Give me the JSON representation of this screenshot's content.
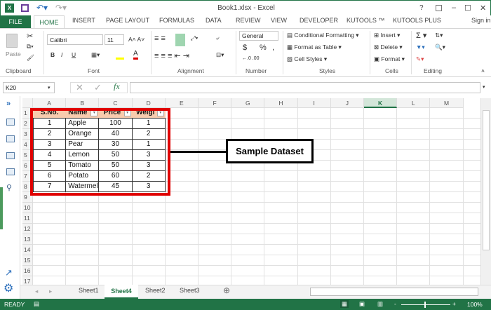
{
  "window": {
    "title": "Book1.xlsx - Excel",
    "help": "?",
    "minimize": "–",
    "maximize": "☐",
    "close": "✕"
  },
  "ribbon_tabs": [
    "FILE",
    "HOME",
    "INSERT",
    "PAGE LAYOUT",
    "FORMULAS",
    "DATA",
    "REVIEW",
    "VIEW",
    "DEVELOPER",
    "KUTOOLS ™",
    "KUTOOLS PLUS"
  ],
  "sign_in": "Sign in",
  "ribbon": {
    "paste": "Paste",
    "font_name": "Calibri",
    "font_size": "11",
    "bold": "B",
    "italic": "I",
    "underline": "U",
    "number_format": "General",
    "currency": "$",
    "percent": "%",
    "comma": ",",
    "conditional_formatting": "Conditional Formatting ▾",
    "format_as_table": "Format as Table ▾",
    "cell_styles": "Cell Styles ▾",
    "insert": "Insert ▾",
    "delete": "Delete ▾",
    "format": "Format ▾",
    "sum": "Σ ▾",
    "groups": [
      "Clipboard",
      "Font",
      "Alignment",
      "Number",
      "Styles",
      "Cells",
      "Editing"
    ]
  },
  "formula_bar": {
    "name_box": "K20",
    "fx": "fx",
    "cancel": "✕",
    "enter": "✓",
    "value": ""
  },
  "columns": [
    "A",
    "B",
    "C",
    "D",
    "E",
    "F",
    "G",
    "H",
    "I",
    "J",
    "K",
    "L",
    "M"
  ],
  "rows": [
    "1",
    "2",
    "3",
    "4",
    "5",
    "6",
    "7",
    "8",
    "9",
    "10",
    "11",
    "12",
    "13",
    "14",
    "15",
    "16",
    "17"
  ],
  "selected_column": "K",
  "table": {
    "headers": [
      "S.No.",
      "Name",
      "Price",
      "Weigl"
    ],
    "rows": [
      [
        "1",
        "Apple",
        "100",
        "1"
      ],
      [
        "2",
        "Orange",
        "40",
        "2"
      ],
      [
        "3",
        "Pear",
        "30",
        "1"
      ],
      [
        "4",
        "Lemon",
        "50",
        "3"
      ],
      [
        "5",
        "Tomato",
        "50",
        "3"
      ],
      [
        "6",
        "Potato",
        "60",
        "2"
      ],
      [
        "7",
        "Watermel",
        "45",
        "3"
      ]
    ]
  },
  "callout": "Sample Dataset",
  "sheets": [
    "Sheet1",
    "Sheet4",
    "Sheet2",
    "Sheet3"
  ],
  "active_sheet": "Sheet4",
  "status": {
    "ready": "READY",
    "zoom": "100%"
  },
  "colors": {
    "excel_green": "#217346",
    "header_fill": "#f8cbad",
    "highlight": "#e00000"
  }
}
